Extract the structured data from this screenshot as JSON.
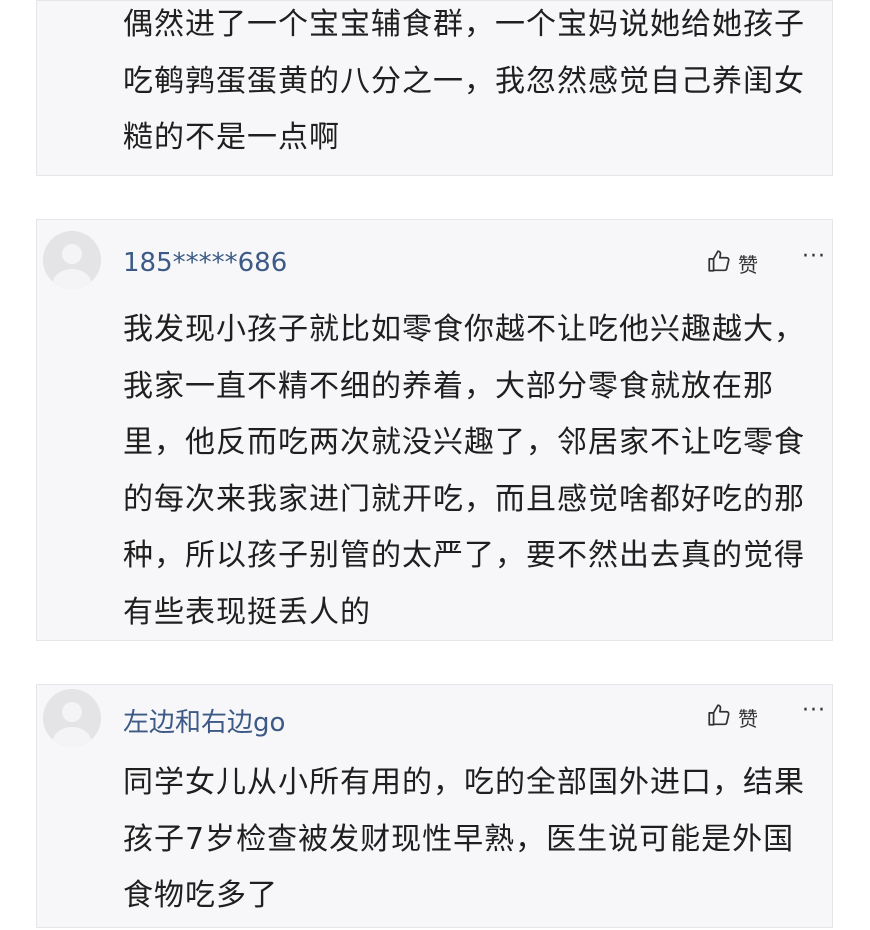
{
  "comments": [
    {
      "text": "偶然进了一个宝宝辅食群，一个宝妈说她给她孩子吃鹌鹑蛋蛋黄的八分之一，我忽然感觉自己养闺女糙的不是一点啊"
    },
    {
      "username": "185*****686",
      "like_label": "赞",
      "more_label": "···",
      "text": "我发现小孩子就比如零食你越不让吃他兴趣越大，我家一直不精不细的养着，大部分零食就放在那里，他反而吃两次就没兴趣了，邻居家不让吃零食的每次来我家进门就开吃，而且感觉啥都好吃的那种，所以孩子别管的太严了，要不然出去真的觉得有些表现挺丢人的"
    },
    {
      "username": "左边和右边go",
      "like_label": "赞",
      "more_label": "···",
      "text": "同学女儿从小所有用的，吃的全部国外进口，结果孩子7岁检查被发财现性早熟，医生说可能是外国食物吃多了"
    }
  ],
  "icons": {
    "avatar": "default-avatar-icon",
    "like": "thumbs-up-icon",
    "more": "more-dots-icon"
  },
  "colors": {
    "username": "#3c5a85",
    "card_background": "#f7f7f9",
    "card_border": "#e6e6ea"
  }
}
